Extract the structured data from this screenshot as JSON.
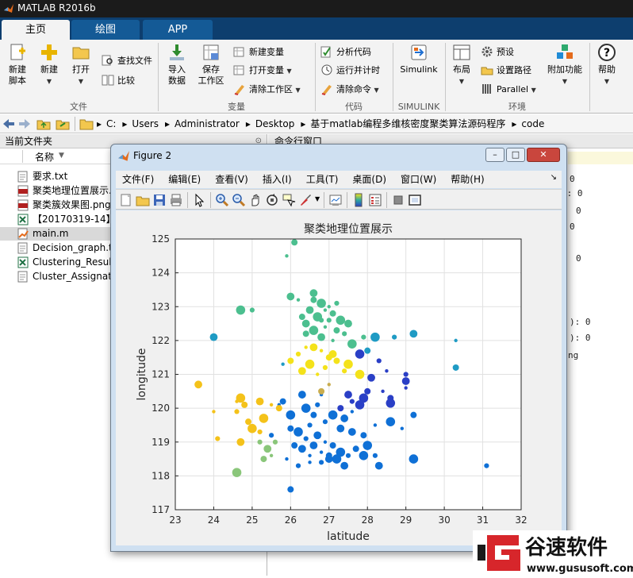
{
  "app": {
    "title": "MATLAB R2016b",
    "tabs": [
      {
        "label": "主页"
      },
      {
        "label": "绘图"
      },
      {
        "label": "APP"
      }
    ]
  },
  "ribbon": {
    "file": {
      "new_script": "新建\n脚本",
      "new": "新建",
      "open": "打开",
      "find_files": "查找文件",
      "compare": "比较",
      "group": "文件"
    },
    "variable": {
      "import": "导入\n数据",
      "save_ws": "保存\n工作区",
      "new_var": "新建变量",
      "open_var": "打开变量",
      "clear_ws": "清除工作区",
      "group": "变量"
    },
    "code": {
      "analyze": "分析代码",
      "run_time": "运行并计时",
      "clear_cmd": "清除命令",
      "group": "代码"
    },
    "simulink": {
      "label": "Simulink",
      "group": "SIMULINK"
    },
    "env": {
      "layout": "布局",
      "prefs": "预设",
      "set_path": "设置路径",
      "parallel": "Parallel",
      "addons": "附加功能",
      "group": "环境"
    },
    "help": "帮助"
  },
  "address": {
    "crumbs": [
      "C:",
      "Users",
      "Administrator",
      "Desktop",
      "基于matlab编程多维核密度聚类算法源码程序",
      "code"
    ]
  },
  "current_folder": {
    "title": "当前文件夹",
    "column": "名称",
    "files": [
      {
        "name": "要求.txt",
        "type": "txt"
      },
      {
        "name": "聚类地理位置展示.",
        "type": "png"
      },
      {
        "name": "聚类簇效果图.png",
        "type": "png"
      },
      {
        "name": "【20170319-14】",
        "type": "xls"
      },
      {
        "name": "main.m",
        "type": "m",
        "selected": true
      },
      {
        "name": "Decision_graph.t",
        "type": "txt"
      },
      {
        "name": "Clustering_Result",
        "type": "xls"
      },
      {
        "name": "Cluster_Assignati",
        "type": "txt"
      }
    ]
  },
  "command_window": {
    "title": "命令行窗口",
    "fragments": [
      "0",
      "): 0",
      "0",
      "0",
      "0",
      "): 0",
      "): 0",
      "ng"
    ]
  },
  "figure": {
    "title": "Figure 2",
    "menus": [
      "文件(F)",
      "编辑(E)",
      "查看(V)",
      "插入(I)",
      "工具(T)",
      "桌面(D)",
      "窗口(W)",
      "帮助(H)"
    ],
    "icons": [
      "new-figure-icon",
      "open-file-icon",
      "save-icon",
      "print-icon",
      "pointer-icon",
      "zoom-in-icon",
      "zoom-out-icon",
      "pan-hand-icon",
      "rotate-3d-icon",
      "data-cursor-icon",
      "brush-icon",
      "link-plot-icon",
      "insert-colorbar-icon",
      "insert-legend-icon",
      "hide-plot-tools-icon",
      "show-plot-tools-icon"
    ]
  },
  "chart_data": {
    "type": "scatter",
    "title": "聚类地理位置展示",
    "xlabel": "latitude",
    "ylabel": "longitude",
    "xlim": [
      23,
      32
    ],
    "ylim": [
      117,
      125
    ],
    "xticks": [
      23,
      24,
      25,
      26,
      27,
      28,
      29,
      30,
      31,
      32
    ],
    "yticks": [
      117,
      118,
      119,
      120,
      121,
      122,
      123,
      124,
      125
    ],
    "grid": true,
    "series": [
      {
        "color": "#4cbf8f",
        "points": [
          [
            25.9,
            124.5
          ],
          [
            26.1,
            124.9
          ],
          [
            24.7,
            122.9
          ],
          [
            25.0,
            122.9
          ],
          [
            26.0,
            123.3
          ],
          [
            26.2,
            123.2
          ],
          [
            26.6,
            123.2
          ],
          [
            26.8,
            123.1
          ],
          [
            27.2,
            123.1
          ],
          [
            26.5,
            122.9
          ],
          [
            26.9,
            122.9
          ],
          [
            27.1,
            122.8
          ],
          [
            26.7,
            122.7
          ],
          [
            27.0,
            122.6
          ],
          [
            26.4,
            122.5
          ],
          [
            26.9,
            122.4
          ],
          [
            27.2,
            122.3
          ],
          [
            26.6,
            122.3
          ],
          [
            27.4,
            122.2
          ],
          [
            26.8,
            122.1
          ],
          [
            27.1,
            122.0
          ],
          [
            26.4,
            122.2
          ],
          [
            27.6,
            121.9
          ],
          [
            27.9,
            122.1
          ],
          [
            26.6,
            123.4
          ],
          [
            27.0,
            123.0
          ],
          [
            26.3,
            122.7
          ],
          [
            27.3,
            122.6
          ],
          [
            26.8,
            122.6
          ],
          [
            27.5,
            122.5
          ]
        ]
      },
      {
        "color": "#1f9bc4",
        "points": [
          [
            24.0,
            122.1
          ],
          [
            25.8,
            121.3
          ],
          [
            28.0,
            121.7
          ],
          [
            28.2,
            122.1
          ],
          [
            28.7,
            122.1
          ],
          [
            29.2,
            122.2
          ],
          [
            30.3,
            122.0
          ],
          [
            30.3,
            121.2
          ]
        ]
      },
      {
        "color": "#f4e21a",
        "points": [
          [
            26.2,
            121.6
          ],
          [
            26.6,
            121.8
          ],
          [
            26.8,
            121.7
          ],
          [
            27.0,
            121.5
          ],
          [
            26.5,
            121.3
          ],
          [
            26.9,
            121.2
          ],
          [
            26.3,
            121.1
          ],
          [
            26.7,
            121.0
          ],
          [
            27.2,
            121.4
          ],
          [
            27.5,
            121.3
          ],
          [
            27.4,
            121.1
          ],
          [
            27.1,
            121.6
          ],
          [
            26.4,
            121.8
          ],
          [
            26.0,
            121.4
          ],
          [
            27.8,
            121.0
          ]
        ]
      },
      {
        "color": "#2a3fc6",
        "points": [
          [
            27.8,
            121.6
          ],
          [
            28.3,
            121.4
          ],
          [
            28.1,
            120.9
          ],
          [
            28.5,
            121.1
          ],
          [
            28.0,
            120.5
          ],
          [
            27.9,
            120.3
          ],
          [
            27.6,
            120.2
          ],
          [
            27.5,
            120.4
          ],
          [
            28.4,
            120.5
          ],
          [
            28.6,
            120.3
          ],
          [
            28.6,
            120.15
          ],
          [
            29.0,
            121.0
          ],
          [
            29.0,
            120.8
          ],
          [
            29.0,
            120.6
          ],
          [
            27.3,
            120.0
          ],
          [
            27.8,
            120.1
          ]
        ]
      },
      {
        "color": "#0f70d6",
        "points": [
          [
            26.0,
            119.4
          ],
          [
            26.2,
            119.3
          ],
          [
            26.4,
            119.1
          ],
          [
            26.6,
            118.9
          ],
          [
            26.8,
            118.7
          ],
          [
            27.0,
            118.6
          ],
          [
            27.2,
            118.5
          ],
          [
            26.5,
            119.5
          ],
          [
            26.7,
            119.2
          ],
          [
            26.9,
            119.0
          ],
          [
            27.1,
            118.9
          ],
          [
            27.3,
            118.7
          ],
          [
            27.5,
            118.6
          ],
          [
            26.3,
            118.8
          ],
          [
            26.5,
            118.6
          ],
          [
            27.7,
            118.8
          ],
          [
            27.9,
            118.6
          ],
          [
            26.8,
            118.4
          ],
          [
            27.0,
            118.5
          ],
          [
            25.9,
            118.5
          ],
          [
            26.1,
            118.9
          ],
          [
            26.4,
            120.0
          ],
          [
            26.7,
            120.1
          ],
          [
            26.3,
            120.4
          ],
          [
            26.8,
            120.4
          ],
          [
            25.8,
            120.2
          ],
          [
            26.0,
            119.8
          ],
          [
            25.5,
            119.2
          ],
          [
            27.6,
            119.3
          ],
          [
            28.2,
            119.5
          ],
          [
            27.9,
            119.2
          ],
          [
            28.0,
            118.9
          ],
          [
            28.2,
            118.6
          ],
          [
            28.3,
            118.3
          ],
          [
            28.9,
            119.4
          ],
          [
            29.2,
            119.8
          ],
          [
            29.2,
            118.5
          ],
          [
            31.1,
            118.3
          ],
          [
            27.3,
            119.4
          ],
          [
            26.5,
            118.4
          ],
          [
            26.0,
            117.6
          ],
          [
            27.1,
            119.8
          ],
          [
            26.9,
            119.6
          ],
          [
            27.4,
            119.7
          ],
          [
            27.6,
            119.9
          ],
          [
            26.6,
            119.8
          ],
          [
            28.6,
            119.6
          ],
          [
            26.2,
            118.3
          ],
          [
            27.4,
            118.3
          ],
          [
            25.7,
            120.1
          ]
        ]
      },
      {
        "color": "#c9ad4f",
        "points": [
          [
            27.0,
            120.7
          ],
          [
            26.8,
            120.5
          ]
        ]
      },
      {
        "color": "#f4c21a",
        "points": [
          [
            23.6,
            120.7
          ],
          [
            24.6,
            120.2
          ],
          [
            24.8,
            120.1
          ],
          [
            24.7,
            120.3
          ],
          [
            24.6,
            119.9
          ],
          [
            25.2,
            120.2
          ],
          [
            25.5,
            120.1
          ],
          [
            25.7,
            120.0
          ],
          [
            25.3,
            119.7
          ],
          [
            24.1,
            119.1
          ],
          [
            24.7,
            119.0
          ],
          [
            24.0,
            119.9
          ],
          [
            24.9,
            119.6
          ],
          [
            25.0,
            119.4
          ],
          [
            25.2,
            119.3
          ]
        ]
      },
      {
        "color": "#8ac67a",
        "points": [
          [
            25.2,
            119.0
          ],
          [
            25.4,
            118.8
          ],
          [
            25.5,
            118.6
          ],
          [
            25.3,
            118.5
          ],
          [
            24.6,
            118.1
          ],
          [
            25.6,
            119.0
          ]
        ]
      }
    ]
  }
}
